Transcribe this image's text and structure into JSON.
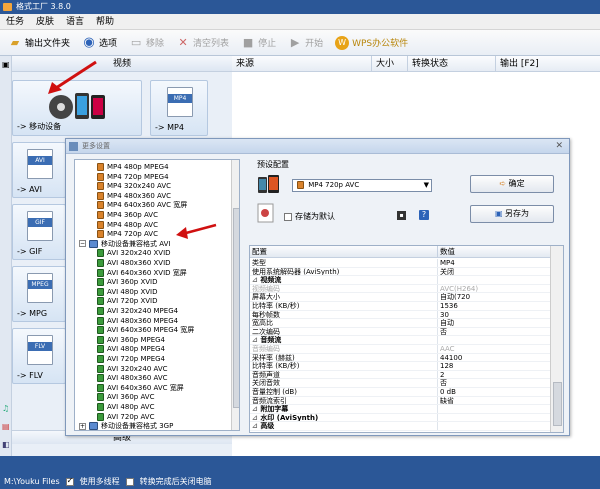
{
  "app": {
    "title": "格式工厂 3.8.0"
  },
  "menu": [
    "任务",
    "皮肤",
    "语言",
    "帮助"
  ],
  "toolbar": {
    "output_folder": "输出文件夹",
    "options": "选项",
    "remove": "移除",
    "clear_list": "清空列表",
    "stop": "停止",
    "start": "开始",
    "wps": "WPS办公软件"
  },
  "left": {
    "video_header": "视频",
    "tiles": [
      {
        "label": "-> 移动设备"
      },
      {
        "label": "-> MP4",
        "icon": "MP4"
      },
      {
        "label": "-> AVI",
        "icon": "AVI"
      },
      {
        "label": "-> GIF",
        "icon": "GIF"
      },
      {
        "label": "-> MPG",
        "icon": "MPEG"
      },
      {
        "label": "-> FLV",
        "icon": "FLV"
      }
    ],
    "advanced": "高级"
  },
  "grid": {
    "headers": [
      "来源",
      "大小",
      "转换状态",
      "输出 [F2]"
    ]
  },
  "status": {
    "path": "M:\\Youku Files",
    "multithread": "使用多线程",
    "shutdown": "转换完成后关闭电脑"
  },
  "dialog": {
    "title": "更多设置",
    "tree": [
      {
        "label": "MP4 480p MPEG4",
        "kind": "mp4"
      },
      {
        "label": "MP4 720p MPEG4",
        "kind": "mp4"
      },
      {
        "label": "MP4 320x240 AVC",
        "kind": "mp4"
      },
      {
        "label": "MP4 480x360 AVC",
        "kind": "mp4"
      },
      {
        "label": "MP4 640x360 AVC 宽屏",
        "kind": "mp4"
      },
      {
        "label": "MP4 360p AVC",
        "kind": "mp4"
      },
      {
        "label": "MP4 480p AVC",
        "kind": "mp4"
      },
      {
        "label": "MP4 720p AVC",
        "kind": "mp4"
      },
      {
        "label": "移动设备兼容格式 AVI",
        "kind": "group"
      },
      {
        "label": "AVI 320x240 XVID",
        "kind": "avi"
      },
      {
        "label": "AVI 480x360 XVID",
        "kind": "avi"
      },
      {
        "label": "AVI 640x360 XVID 宽屏",
        "kind": "avi"
      },
      {
        "label": "AVI 360p XVID",
        "kind": "avi"
      },
      {
        "label": "AVI 480p XVID",
        "kind": "avi"
      },
      {
        "label": "AVI 720p XVID",
        "kind": "avi"
      },
      {
        "label": "AVI 320x240 MPEG4",
        "kind": "avi"
      },
      {
        "label": "AVI 480x360 MPEG4",
        "kind": "avi"
      },
      {
        "label": "AVI 640x360 MPEG4 宽屏",
        "kind": "avi"
      },
      {
        "label": "AVI 360p MPEG4",
        "kind": "avi"
      },
      {
        "label": "AVI 480p MPEG4",
        "kind": "avi"
      },
      {
        "label": "AVI 720p MPEG4",
        "kind": "avi"
      },
      {
        "label": "AVI 320x240 AVC",
        "kind": "avi"
      },
      {
        "label": "AVI 480x360 AVC",
        "kind": "avi"
      },
      {
        "label": "AVI 640x360 AVC 宽屏",
        "kind": "avi"
      },
      {
        "label": "AVI 360p AVC",
        "kind": "avi"
      },
      {
        "label": "AVI 480p AVC",
        "kind": "avi"
      },
      {
        "label": "AVI 720p AVC",
        "kind": "avi"
      },
      {
        "label": "移动设备兼容格式 3GP",
        "kind": "group"
      },
      {
        "label": "HD AVC",
        "kind": "group"
      }
    ],
    "preset_label": "预设配置",
    "preset_value": "MP4 720p AVC",
    "ok": "确定",
    "set_default": "存储为默认",
    "save_as": "另存为",
    "prop_headers": [
      "配置",
      "数值"
    ],
    "props": [
      {
        "k": "类型",
        "v": "MP4"
      },
      {
        "k": "使用系统解码器 (AviSynth)",
        "v": "关闭"
      },
      {
        "k": "视频流",
        "v": "",
        "sec": true
      },
      {
        "k": "视频编码",
        "v": "AVC(H264)",
        "dis": true
      },
      {
        "k": "屏幕大小",
        "v": "自动(720"
      },
      {
        "k": "比特率 (KB/秒)",
        "v": "1536"
      },
      {
        "k": "每秒帧数",
        "v": "30"
      },
      {
        "k": "宽高比",
        "v": "自动"
      },
      {
        "k": "二次编码",
        "v": "否"
      },
      {
        "k": "音频流",
        "v": "",
        "sec": true
      },
      {
        "k": "音频编码",
        "v": "AAC",
        "dis": true
      },
      {
        "k": "采样率 (赫兹)",
        "v": "44100"
      },
      {
        "k": "比特率 (KB/秒)",
        "v": "128"
      },
      {
        "k": "音频声道",
        "v": "2"
      },
      {
        "k": "关闭音效",
        "v": "否"
      },
      {
        "k": "音量控制 (dB)",
        "v": "0 dB"
      },
      {
        "k": "音频流索引",
        "v": "缺省"
      },
      {
        "k": "附加字幕",
        "v": "",
        "sec": true
      },
      {
        "k": "水印 (AviSynth)",
        "v": "",
        "sec": true
      },
      {
        "k": "高级",
        "v": "",
        "sec": true
      }
    ]
  }
}
